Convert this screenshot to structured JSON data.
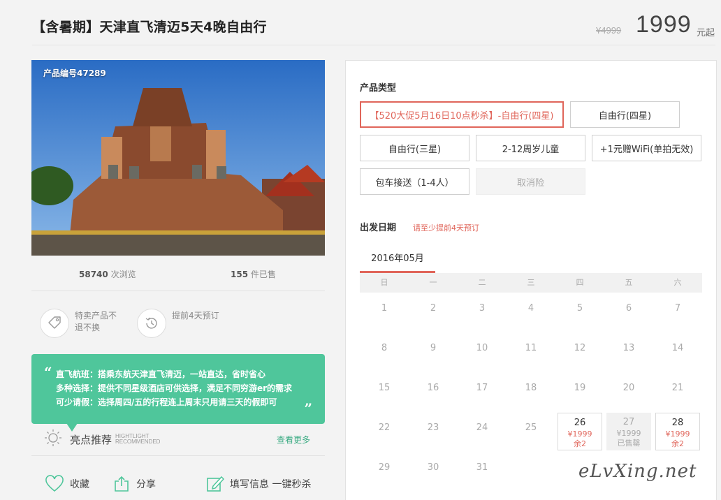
{
  "header": {
    "title": "【含暑期】天津直飞清迈5天4晚自由行",
    "old_price": "¥4999",
    "price": "1999",
    "price_unit": "元起"
  },
  "product": {
    "id_label": "产品编号47289",
    "views_num": "58740",
    "views_label": " 次浏览",
    "sold_num": "155",
    "sold_label": " 件已售"
  },
  "features": [
    {
      "icon": "tag-icon",
      "text": "特卖产品不退不换"
    },
    {
      "icon": "clock-history-icon",
      "text": "提前4天预订"
    }
  ],
  "quote": {
    "open": "“",
    "close": "”",
    "lines": [
      "直飞航班：搭乘东航天津直飞清迈，一站直达，省时省心",
      "多种选择：提供不同星级酒店可供选择，满足不同穷游er的需求",
      "可少请假：选择周四/五的行程连上周末只用请三天的假即可"
    ]
  },
  "highlight": {
    "title": "亮点推荐",
    "sub1": "HIGHTLIGHT",
    "sub2": "RECOMMENDED",
    "more": "查看更多"
  },
  "actions": {
    "favorite": "收藏",
    "share": "分享",
    "book": "填写信息 一键秒杀"
  },
  "booking": {
    "type_label": "产品类型",
    "options": [
      "【520大促5月16日10点秒杀】-自由行(四星)",
      "自由行(四星)",
      "自由行(三星)",
      "2-12周岁儿童",
      "+1元赠WiFi(单拍无效)",
      "包车接送（1-4人）",
      "取消险"
    ],
    "date_label": "出发日期",
    "date_note": "请至少提前4天预订",
    "month": "2016年05月",
    "weekdays": [
      "日",
      "一",
      "二",
      "三",
      "四",
      "五",
      "六"
    ],
    "days": [
      {
        "d": "1"
      },
      {
        "d": "2"
      },
      {
        "d": "3"
      },
      {
        "d": "4"
      },
      {
        "d": "5"
      },
      {
        "d": "6"
      },
      {
        "d": "7"
      },
      {
        "d": "8"
      },
      {
        "d": "9"
      },
      {
        "d": "10"
      },
      {
        "d": "11"
      },
      {
        "d": "12"
      },
      {
        "d": "13"
      },
      {
        "d": "14"
      },
      {
        "d": "15"
      },
      {
        "d": "16"
      },
      {
        "d": "17"
      },
      {
        "d": "18"
      },
      {
        "d": "19"
      },
      {
        "d": "20"
      },
      {
        "d": "21"
      },
      {
        "d": "22"
      },
      {
        "d": "23"
      },
      {
        "d": "24"
      },
      {
        "d": "25"
      },
      {
        "d": "26",
        "price": "¥1999",
        "left": "余2",
        "state": "avail"
      },
      {
        "d": "27",
        "price": "¥1999",
        "left": "已售罄",
        "state": "sold"
      },
      {
        "d": "28",
        "price": "¥1999",
        "left": "余2",
        "state": "avail"
      },
      {
        "d": "29"
      },
      {
        "d": "30"
      },
      {
        "d": "31"
      }
    ]
  },
  "watermark": "eLvXing.net",
  "colors": {
    "accent": "#e0655a",
    "green": "#4fc69b"
  }
}
